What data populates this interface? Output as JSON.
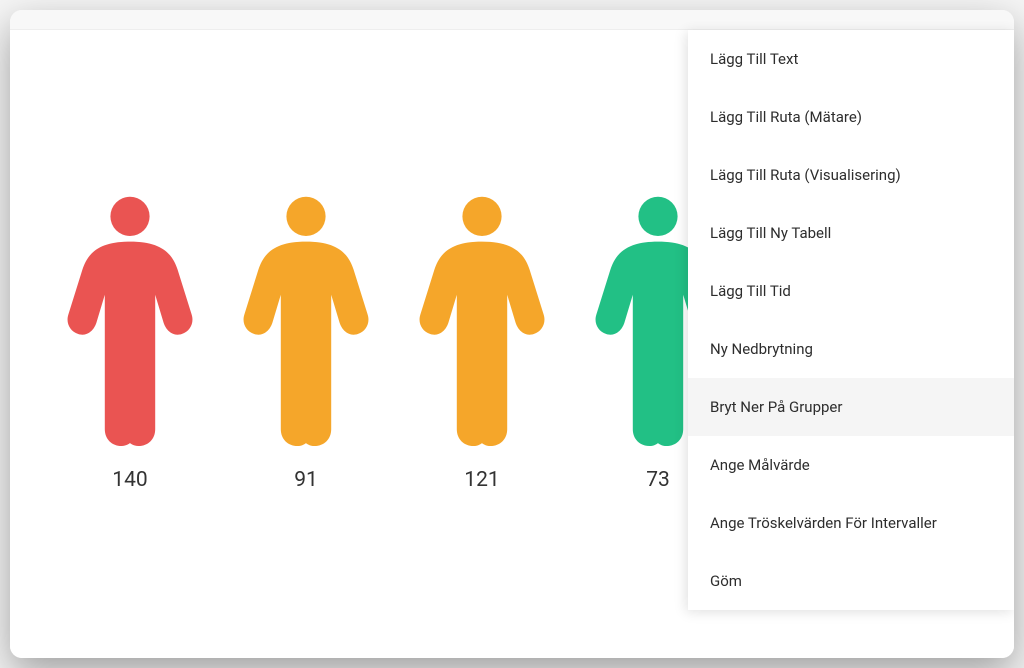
{
  "colors": {
    "red": "#ea5452",
    "orange": "#f5a62a",
    "green": "#22c085"
  },
  "people": [
    {
      "value": "140",
      "color": "red"
    },
    {
      "value": "91",
      "color": "orange"
    },
    {
      "value": "121",
      "color": "orange"
    },
    {
      "value": "73",
      "color": "green"
    }
  ],
  "menu": {
    "items": [
      {
        "label": "Lägg Till Text",
        "highlighted": false
      },
      {
        "label": "Lägg Till Ruta (Mätare)",
        "highlighted": false
      },
      {
        "label": "Lägg Till Ruta (Visualisering)",
        "highlighted": false
      },
      {
        "label": "Lägg Till Ny Tabell",
        "highlighted": false
      },
      {
        "label": "Lägg Till Tid",
        "highlighted": false
      },
      {
        "label": "Ny Nedbrytning",
        "highlighted": false
      },
      {
        "label": "Bryt Ner På Grupper",
        "highlighted": true
      },
      {
        "label": "Ange Målvärde",
        "highlighted": false
      },
      {
        "label": "Ange Tröskelvärden För Intervaller",
        "highlighted": false
      },
      {
        "label": "Göm",
        "highlighted": false
      }
    ]
  }
}
